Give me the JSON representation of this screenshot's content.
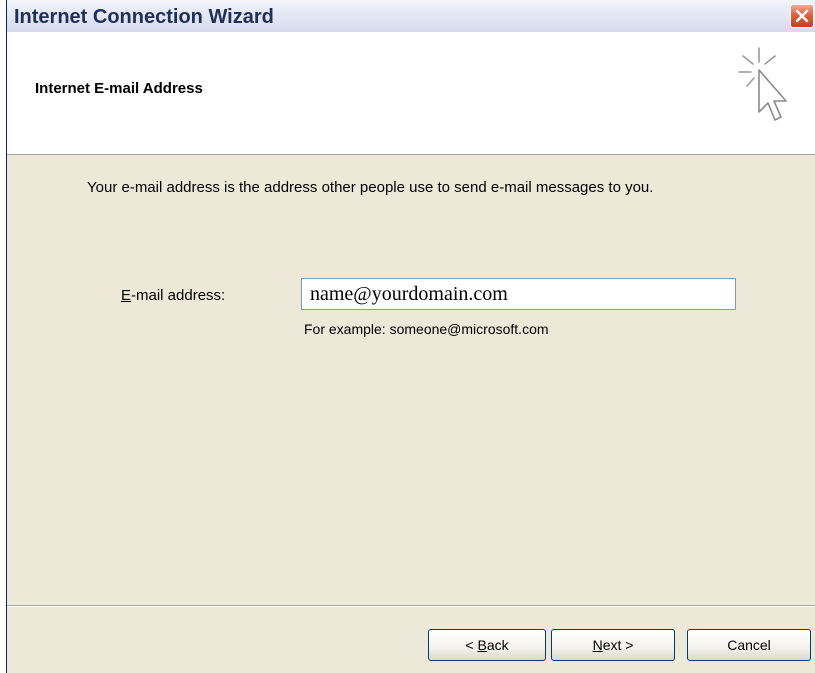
{
  "window": {
    "title": "Internet Connection Wizard",
    "close_icon": "close-icon"
  },
  "header": {
    "title": "Internet E-mail Address",
    "icon": "wizard-cursor-sparkle-icon"
  },
  "content": {
    "description": "Your e-mail address is the address other people use to send e-mail messages to you.",
    "email_label": {
      "mnemonic": "E",
      "rest": "-mail address:"
    },
    "email_value": "name@yourdomain.com",
    "example": "For example: someone@microsoft.com"
  },
  "buttons": {
    "back": {
      "prefix": "< ",
      "mnemonic": "B",
      "rest": "ack"
    },
    "next": {
      "prefix": "",
      "mnemonic": "N",
      "rest": "ext >"
    },
    "cancel": "Cancel"
  },
  "colors": {
    "dialog_bg": "#ece9d8",
    "header_bg": "#ffffff",
    "close_red": "#e0603c",
    "input_border": "#7f9db9"
  }
}
